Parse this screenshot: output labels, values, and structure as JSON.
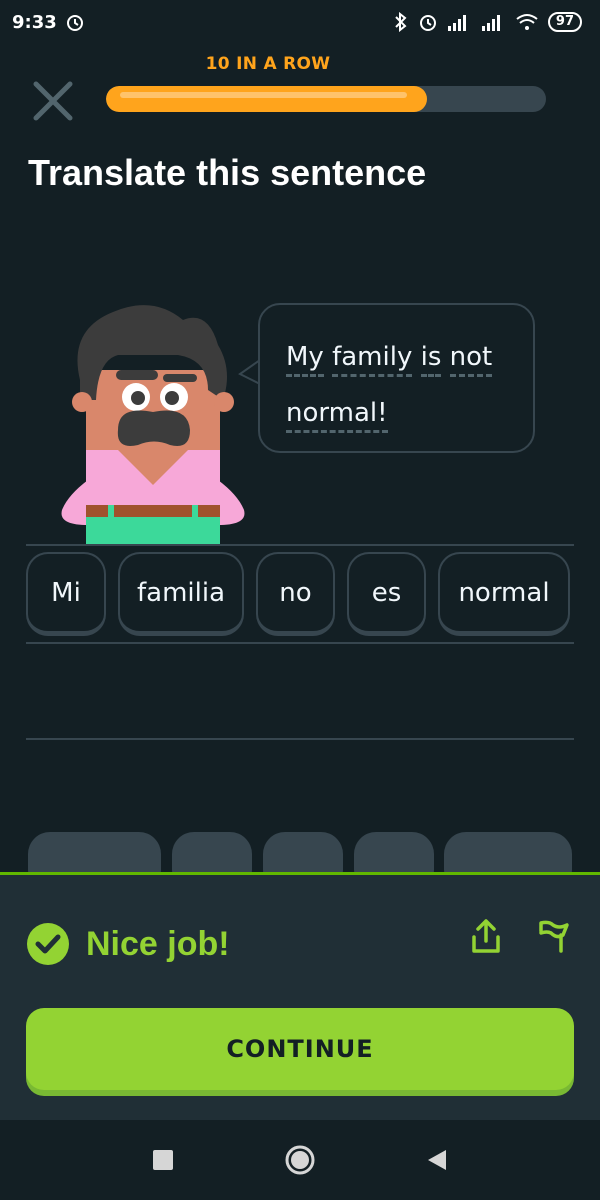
{
  "status_bar": {
    "time": "9:33",
    "battery": "97",
    "icons": [
      "alarm-icon",
      "bluetooth-icon",
      "alarm-icon",
      "signal-icon",
      "signal-icon",
      "wifi-icon",
      "battery-icon"
    ]
  },
  "header": {
    "streak_label": "10 IN A ROW",
    "progress": 0.73,
    "close_icon": "close-icon"
  },
  "prompt": {
    "title": "Translate this sentence",
    "sentence_words": [
      "My",
      "family",
      "is",
      "not",
      "normal!"
    ]
  },
  "answer": {
    "words": [
      "Mi",
      "familia",
      "no",
      "es",
      "normal"
    ]
  },
  "feedback": {
    "message": "Nice job!",
    "continue_label": "CONTINUE",
    "icons": [
      "check-circle-icon",
      "share-icon",
      "flag-icon"
    ]
  },
  "colors": {
    "background": "#131f24",
    "accent_orange": "#ffa41c",
    "success_green": "#93d333",
    "panel": "#202f36",
    "border": "#37464f"
  },
  "nav_bar": {
    "icons": [
      "recents-icon",
      "home-icon",
      "back-icon"
    ]
  }
}
